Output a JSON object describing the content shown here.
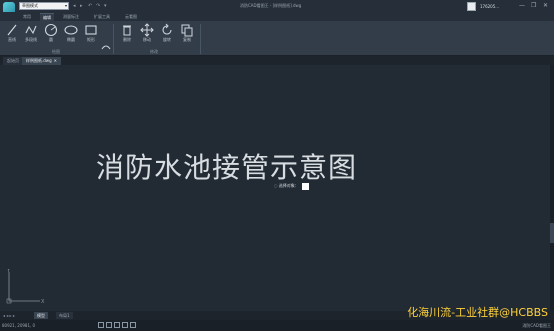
{
  "titlebar": {
    "mode": "草图模式",
    "quick_access": [
      "◂",
      "▸",
      "↶",
      "↷",
      "▾"
    ],
    "doc_title": "消防CAD看图王 - [样例图纸].dwg",
    "user_name": "176205...",
    "window_buttons": [
      "—",
      "❐",
      "✕"
    ]
  },
  "menu": {
    "tabs": [
      "常用",
      "编辑",
      "测量标注",
      "扩展工具",
      "云看图"
    ],
    "active": "编辑"
  },
  "ribbon": {
    "draw_tools": [
      {
        "label": "直线",
        "icon": "line-icon"
      },
      {
        "label": "多段线",
        "icon": "polyline-icon"
      },
      {
        "label": "圆",
        "icon": "circle-icon"
      },
      {
        "label": "椭圆",
        "icon": "ellipse-icon"
      },
      {
        "label": "矩形",
        "icon": "rectangle-icon"
      }
    ],
    "modify_tools": [
      {
        "label": "删除",
        "icon": "trash-icon"
      },
      {
        "label": "移动",
        "icon": "move-icon"
      },
      {
        "label": "旋转",
        "icon": "rotate-icon"
      },
      {
        "label": "复制",
        "icon": "copy-icon"
      }
    ],
    "draw_group": "绘图",
    "modify_group": "修改"
  },
  "doc_tabs": {
    "start_tab": "起始页",
    "active_tab": "样例图纸.dwg",
    "close": "✕"
  },
  "canvas": {
    "drawing_title": "消防水池接管示意图",
    "tooltip": "选择对象："
  },
  "layout": {
    "nav": "◂ ◂ ▸ ▸",
    "tabs": [
      "模型",
      "布局1"
    ],
    "active": "模型"
  },
  "status": {
    "coords": "80921, 20981, 0",
    "right": "消防CAD看图王"
  },
  "watermark": "化海川流-工业社群@HCBBS"
}
